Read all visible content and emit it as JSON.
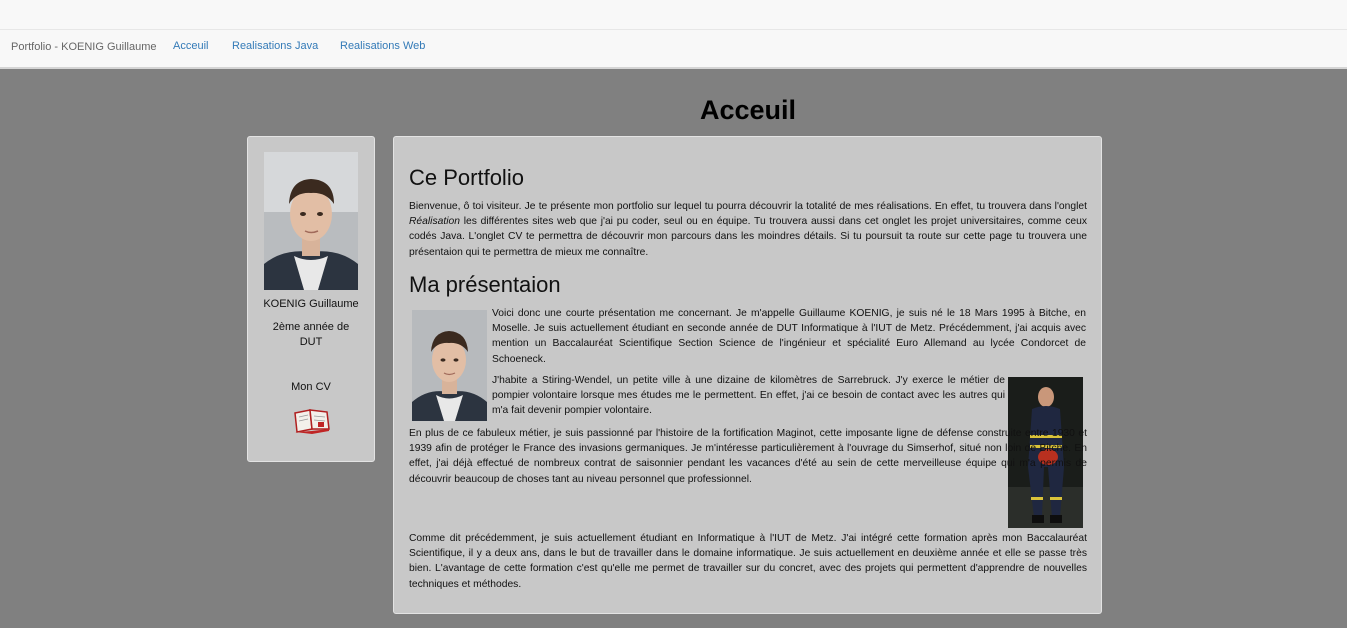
{
  "nav": {
    "brand": "Portfolio - KOENIG Guillaume",
    "links": [
      "Acceuil",
      "Realisations Java",
      "Realisations Web"
    ]
  },
  "page_title": "Acceuil",
  "sidebar": {
    "name": "KOENIG Guillaume",
    "year_line1": "2ème année de",
    "year_line2": "DUT",
    "cv_label": "Mon CV"
  },
  "portfolio": {
    "heading": "Ce Portfolio",
    "text_before": "Bienvenue, ô toi visiteur. Je te présente mon portfolio sur lequel tu pourra découvrir la totalité de mes réalisations. En effet, tu trouvera dans l'onglet ",
    "text_emphasis": "Réalisation",
    "text_after": " les différentes sites web que j'ai pu coder, seul ou en équipe. Tu trouvera aussi dans cet onglet les projet universitaires, comme ceux codés Java. L'onglet CV te permettra de découvrir mon parcours dans les moindres détails. Si tu poursuit ta route sur cette page tu trouvera une présentaion qui te permettra de mieux me connaître."
  },
  "presentation": {
    "heading": "Ma présentaion",
    "p1": "Voici donc une courte présentation me concernant. Je m'appelle Guillaume KOENIG, je suis né le 18 Mars 1995 à Bitche, en Moselle. Je suis actuellement étudiant en seconde année de DUT Informatique à l'IUT de Metz. Précédemment, j'ai acquis avec mention un Baccalauréat Scientifique Section Science de l'ingénieur et spécialité Euro Allemand au lycée Condorcet de Schoeneck.",
    "p2": "J'habite a Stiring-Wendel, un petite ville à une dizaine de kilomètres de Sarrebruck. J'y exerce le métier de pompier volontaire lorsque mes études me le permettent. En effet, j'ai ce besoin de contact avec les autres qui m'a fait devenir pompier volontaire.",
    "p3": "En plus de ce fabuleux métier, je suis passionné par l'histoire de la fortification Maginot, cette imposante ligne de défense construite entre 1930 et 1939 afin de protéger le France des invasions germaniques. Je m'intéresse particulièrement à l'ouvrage du Simserhof, situé non loin de Bitche. En effet, j'ai déjà effectué de nombreux contrat de saisonnier pendant les vacances d'été au sein de cette merveilleuse équipe qui m'a permis de découvrir beaucoup de choses tant au niveau personnel que professionnel.",
    "p4": "Comme dit précédemment, je suis actuellement étudiant en Informatique à l'IUT de Metz. J'ai intégré cette formation après mon Baccalauréat Scientifique, il y a deux ans, dans le but de travailler dans le domaine informatique. Je suis actuellement en deuxième année et elle se passe très bien. L'avantage de cette formation c'est qu'elle me permet de travailler sur du concret, avec des projets qui permettent d'apprendre de nouvelles techniques et méthodes."
  },
  "colors": {
    "background": "#808080",
    "panel": "#c8c8c8",
    "link": "#337ab7"
  }
}
